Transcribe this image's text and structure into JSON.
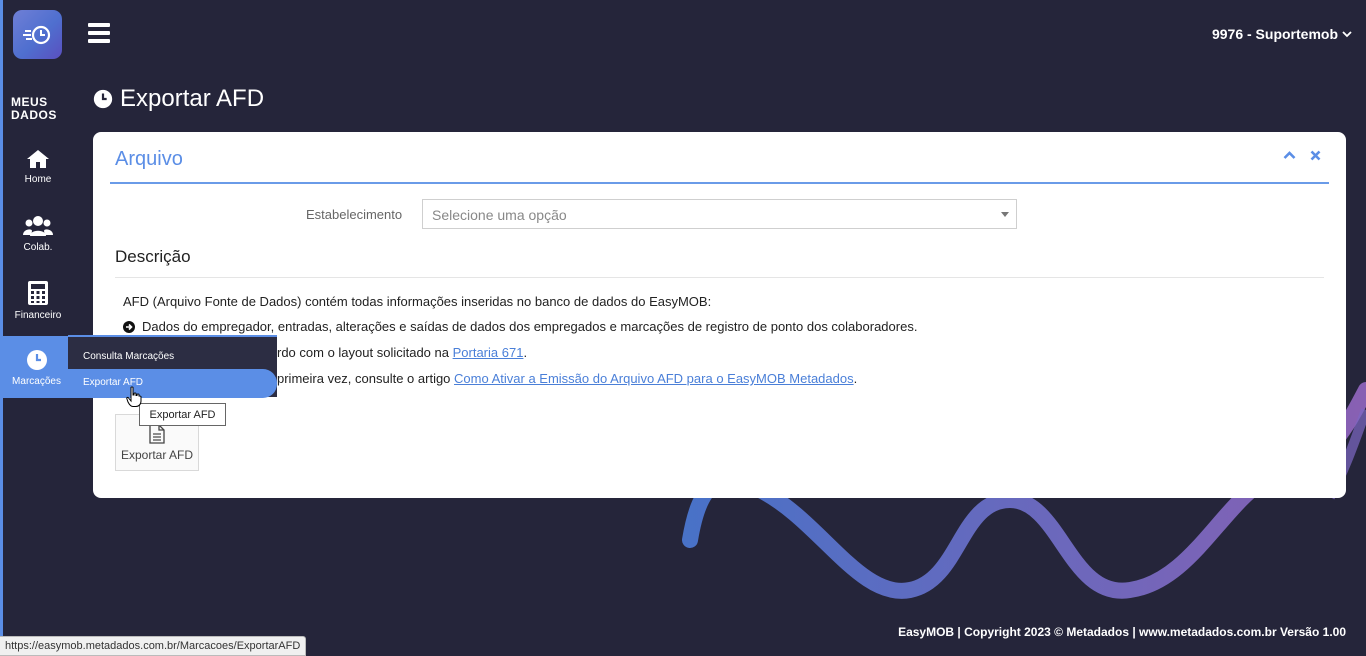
{
  "header": {
    "user_label": "9976 - Suportemob"
  },
  "sidebar": {
    "section_title": "MEUS DADOS",
    "items": [
      {
        "label": "Home",
        "icon": "home-icon"
      },
      {
        "label": "Colab.",
        "icon": "users-icon"
      },
      {
        "label": "Financeiro",
        "icon": "calculator-icon"
      },
      {
        "label": "Marcações",
        "icon": "clock-icon"
      }
    ],
    "flyout": [
      {
        "label": "Consulta Marcações"
      },
      {
        "label": "Exportar AFD"
      }
    ]
  },
  "page": {
    "title": "Exportar AFD"
  },
  "card": {
    "title": "Arquivo",
    "establishment_label": "Estabelecimento",
    "establishment_placeholder": "Selecione uma opção",
    "description_heading": "Descrição",
    "intro": "AFD (Arquivo Fonte de Dados) contém todas informações inseridas no banco de dados do EasyMOB:",
    "bullet": "Dados do empregador, entradas, alterações e saídas de dados dos empregados e marcações de registro de ponto dos colaboradores.",
    "layout_prefix": "rdo com o layout solicitado na ",
    "layout_link": "Portaria 671",
    "layout_suffix": ".",
    "article_prefix": "primeira vez, consulte o artigo ",
    "article_link": "Como Ativar a Emissão do Arquivo AFD para o EasyMOB Metadados",
    "article_suffix": ".",
    "export_button": "Exportar AFD"
  },
  "tooltip": "Exportar AFD",
  "footer": "EasyMOB | Copyright 2023 © Metadados | www.metadados.com.br Versão 1.00",
  "status_url": "https://easymob.metadados.com.br/Marcacoes/ExportarAFD",
  "colors": {
    "background": "#25253a",
    "accent": "#5b8ee6",
    "card": "#ffffff"
  }
}
